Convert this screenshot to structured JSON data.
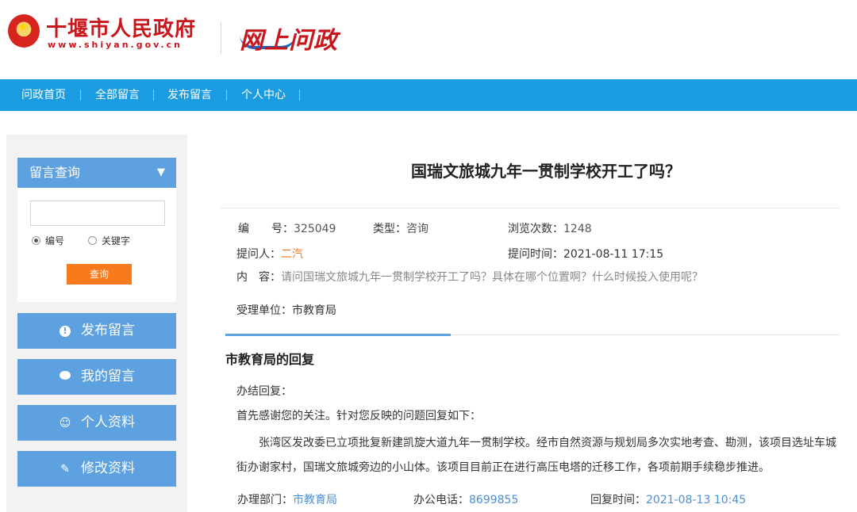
{
  "header": {
    "site_title": "十堰市人民政府",
    "site_url": "www.shiyan.gov.cn",
    "logo_text": "网上问政"
  },
  "nav": {
    "items": [
      "问政首页",
      "全部留言",
      "发布留言",
      "个人中心"
    ]
  },
  "sidebar": {
    "query": {
      "title": "留言查询",
      "input_value": "",
      "radio_options": [
        "编号",
        "关键字"
      ],
      "selected_radio": "编号",
      "button": "查询"
    },
    "buttons": [
      {
        "label": "发布留言",
        "icon": "exclamation-icon"
      },
      {
        "label": "我的留言",
        "icon": "chat-bubble-icon"
      },
      {
        "label": "个人资料",
        "icon": "user-icon"
      },
      {
        "label": "修改资料",
        "icon": "pencil-icon"
      }
    ]
  },
  "question": {
    "title": "国瑞文旅城九年一贯制学校开工了吗？",
    "number_label": "编　　号：",
    "number": "325049",
    "type_label": "类型：",
    "type": "咨询",
    "views_label": "浏览次数：",
    "views": "1248",
    "asker_label": "提问人：",
    "asker": "二汽",
    "time_label": "提问时间：",
    "time": "2021-08-11 17:15",
    "content_label": "内　容：",
    "content": "请问国瑞文旅城九年一贯制学校开工了吗？具体在哪个位置啊？什么时候投入使用呢？",
    "dept_label": "受理单位：",
    "dept": "市教育局"
  },
  "reply": {
    "heading": "市教育局的回复",
    "status": "办结回复：",
    "para1": "首先感谢您的关注。针对您反映的问题回复如下：",
    "para2_line1": "张湾区发改委已立项批复新建凯旋大道九年一贯制学校。经市自然资源与规划局多次实地考查、勘测，该项目选址车城",
    "para2_line2": "街办谢家村，国瑞文旅城旁边的小山体。该项目目前正在进行高压电塔的迁移工作，各项前期手续稳步推进。",
    "dept_label": "办理部门：",
    "dept": "市教育局",
    "phone_label": "办公电话：",
    "phone": "8699855",
    "time_label": "回复时间：",
    "time": "2021-08-13 10:45"
  },
  "colors": {
    "nav_blue": "#1b9be0",
    "side_blue": "#5da1e0",
    "accent_orange": "#f97a1c",
    "brand_red": "#c8161d"
  }
}
